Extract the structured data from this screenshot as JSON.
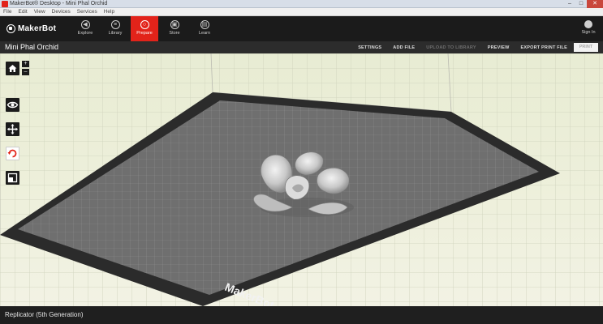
{
  "window": {
    "title": "MakerBot® Desktop - Mini Phal Orchid",
    "controls": [
      "–",
      "□",
      "✕"
    ]
  },
  "menu": [
    "File",
    "Edit",
    "View",
    "Devices",
    "Services",
    "Help"
  ],
  "brand": {
    "logo_text": "MakerBot",
    "accent": "#e2231a"
  },
  "nav": [
    {
      "label": "Explore",
      "icon": "compass-icon",
      "glyph": "◀"
    },
    {
      "label": "Library",
      "icon": "library-icon",
      "glyph": "≡"
    },
    {
      "label": "Prepare",
      "icon": "prepare-icon",
      "glyph": "○",
      "active": true
    },
    {
      "label": "Store",
      "icon": "store-icon",
      "glyph": "▣"
    },
    {
      "label": "Learn",
      "icon": "learn-icon",
      "glyph": "▤"
    }
  ],
  "account": {
    "label": "Sign In",
    "icon": "user-icon"
  },
  "project": {
    "name": "Mini Phal Orchid",
    "actions": [
      {
        "label": "SETTINGS",
        "enabled": true
      },
      {
        "label": "ADD FILE",
        "enabled": true
      },
      {
        "label": "UPLOAD TO LIBRARY",
        "enabled": false
      },
      {
        "label": "PREVIEW",
        "enabled": true
      },
      {
        "label": "EXPORT PRINT FILE",
        "enabled": true
      }
    ],
    "print_button": "PRINT"
  },
  "tools": [
    {
      "name": "view-tool",
      "icon": "eye-icon"
    },
    {
      "name": "move-tool",
      "icon": "move-icon"
    },
    {
      "name": "rotate-tool",
      "icon": "rotate-icon",
      "active": true
    },
    {
      "name": "scale-tool",
      "icon": "scale-icon"
    }
  ],
  "zoom": {
    "in": "+",
    "out": "–"
  },
  "build_plate": {
    "label": "MakerBot"
  },
  "status": {
    "printer": "Replicator (5th Generation)"
  }
}
